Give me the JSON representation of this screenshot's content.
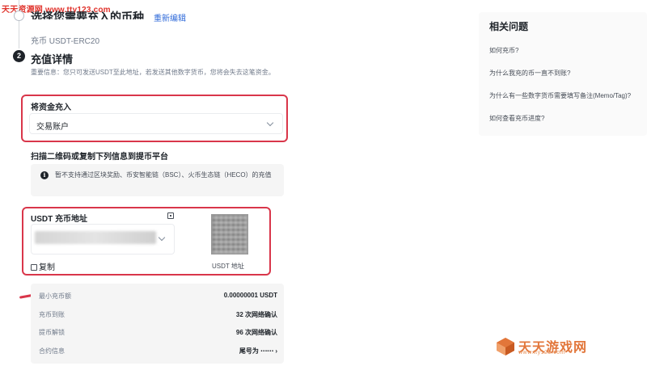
{
  "watermark": {
    "site": "天天资源网 www.tty123.com"
  },
  "step1": {
    "title": "选择您需要充入的币种",
    "edit_label": "重新编辑",
    "coin_line": "充币 USDT-ERC20"
  },
  "step2": {
    "number": "2",
    "title": "充值详情",
    "notice": "重要信息：您只可发送USDT至此地址，若发送其他数字货币，您将会失去这笔资金。"
  },
  "fund_into": {
    "label": "将资金充入",
    "selected": "交易账户"
  },
  "scan": {
    "title": "扫描二维码或复制下列信息到提币平台",
    "warning": "暂不支持通过区块奖励、币安智能链（BSC）、火币生态链（HECO）的充值"
  },
  "address": {
    "label": "USDT 充币地址",
    "copy_label": "复制",
    "qr_caption": "USDT 地址"
  },
  "details": [
    {
      "key": "最小充币额",
      "value": "0.00000001 USDT"
    },
    {
      "key": "充币到账",
      "value": "32 次网络确认"
    },
    {
      "key": "提币解锁",
      "value": "96 次网络确认"
    },
    {
      "key": "合约信息",
      "value": "尾号为 ⋯⋯  ›"
    }
  ],
  "related": {
    "title": "相关问题",
    "questions": [
      "如何充币?",
      "为什么我充的币一直不到账?",
      "为什么有一些数字货币需要填写备注(Memo/Tag)?",
      "如何查看充币进度?"
    ]
  },
  "logo_watermark": {
    "name": "天天游戏网",
    "url": "www.tty123.com"
  },
  "colors": {
    "highlight": "#d9364a",
    "link": "#2f6ad9",
    "logo": "#e2763a"
  },
  "icons": [
    "info-icon",
    "copy-icon",
    "chevron-down-icon",
    "qr-code-image"
  ]
}
